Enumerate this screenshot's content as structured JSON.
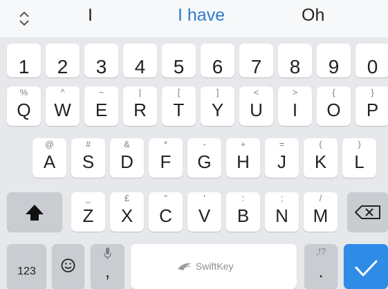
{
  "suggestions": [
    "I",
    "I have",
    "Oh"
  ],
  "number_row": [
    "1",
    "2",
    "3",
    "4",
    "5",
    "6",
    "7",
    "8",
    "9",
    "0"
  ],
  "row1": [
    {
      "key": "Q",
      "alt": "%"
    },
    {
      "key": "W",
      "alt": "^"
    },
    {
      "key": "E",
      "alt": "~"
    },
    {
      "key": "R",
      "alt": "|"
    },
    {
      "key": "T",
      "alt": "["
    },
    {
      "key": "Y",
      "alt": "]"
    },
    {
      "key": "U",
      "alt": "<"
    },
    {
      "key": "I",
      "alt": ">"
    },
    {
      "key": "O",
      "alt": "{"
    },
    {
      "key": "P",
      "alt": "}"
    }
  ],
  "row2": [
    {
      "key": "A",
      "alt": "@"
    },
    {
      "key": "S",
      "alt": "#"
    },
    {
      "key": "D",
      "alt": "&"
    },
    {
      "key": "F",
      "alt": "*"
    },
    {
      "key": "G",
      "alt": "-"
    },
    {
      "key": "H",
      "alt": "+"
    },
    {
      "key": "J",
      "alt": "="
    },
    {
      "key": "K",
      "alt": "("
    },
    {
      "key": "L",
      "alt": ")"
    }
  ],
  "row3": [
    {
      "key": "Z",
      "alt": "_"
    },
    {
      "key": "X",
      "alt": "£"
    },
    {
      "key": "C",
      "alt": "\""
    },
    {
      "key": "V",
      "alt": "'"
    },
    {
      "key": "B",
      "alt": ":"
    },
    {
      "key": "N",
      "alt": ";"
    },
    {
      "key": "M",
      "alt": "/"
    }
  ],
  "bottom": {
    "symbols_label": "123",
    "comma_label": ",",
    "space_label": "SwiftKey",
    "period_label": ".",
    "period_alt": ",!?"
  },
  "icons": {
    "expand": "expand-icon",
    "shift": "shift-icon",
    "backspace": "backspace-icon",
    "emoji": "emoji-icon",
    "mic": "mic-icon",
    "enter": "checkmark-icon",
    "swiftkey_logo": "swiftkey-logo-icon"
  },
  "colors": {
    "accent": "#2e8ce6",
    "suggestion_primary": "#2e7bd1"
  }
}
